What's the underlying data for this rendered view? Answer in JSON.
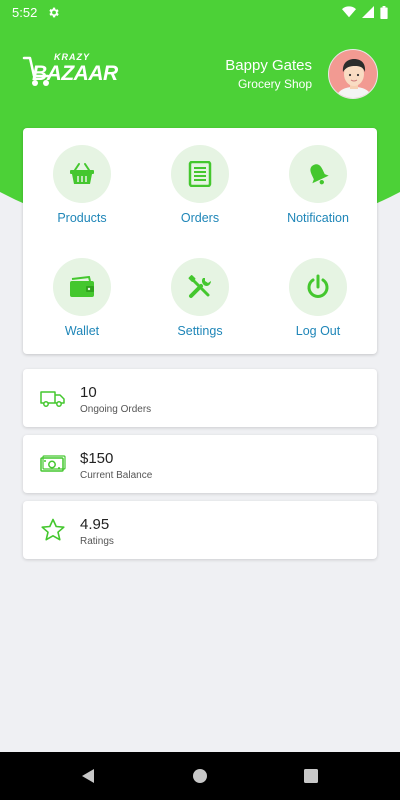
{
  "status_bar": {
    "time": "5:52"
  },
  "brand": {
    "logo_small": "KRAZY",
    "logo_big": "BAZAAR"
  },
  "user": {
    "name": "Bappy Gates",
    "role": "Grocery Shop"
  },
  "menu": {
    "items": [
      {
        "label": "Products",
        "icon": "basket-icon"
      },
      {
        "label": "Orders",
        "icon": "orders-list-icon"
      },
      {
        "label": "Notification",
        "icon": "bell-icon"
      },
      {
        "label": "Wallet",
        "icon": "wallet-icon"
      },
      {
        "label": "Settings",
        "icon": "tools-icon"
      },
      {
        "label": "Log Out",
        "icon": "power-icon"
      }
    ]
  },
  "stats": [
    {
      "value": "10",
      "label": "Ongoing Orders",
      "icon": "truck-icon"
    },
    {
      "value": "$150",
      "label": "Current Balance",
      "icon": "cash-icon"
    },
    {
      "value": "4.95",
      "label": "Ratings",
      "icon": "star-icon"
    }
  ],
  "colors": {
    "accent": "#4cd137",
    "link": "#1f86b8",
    "icon_bg": "#e6f4e3"
  }
}
